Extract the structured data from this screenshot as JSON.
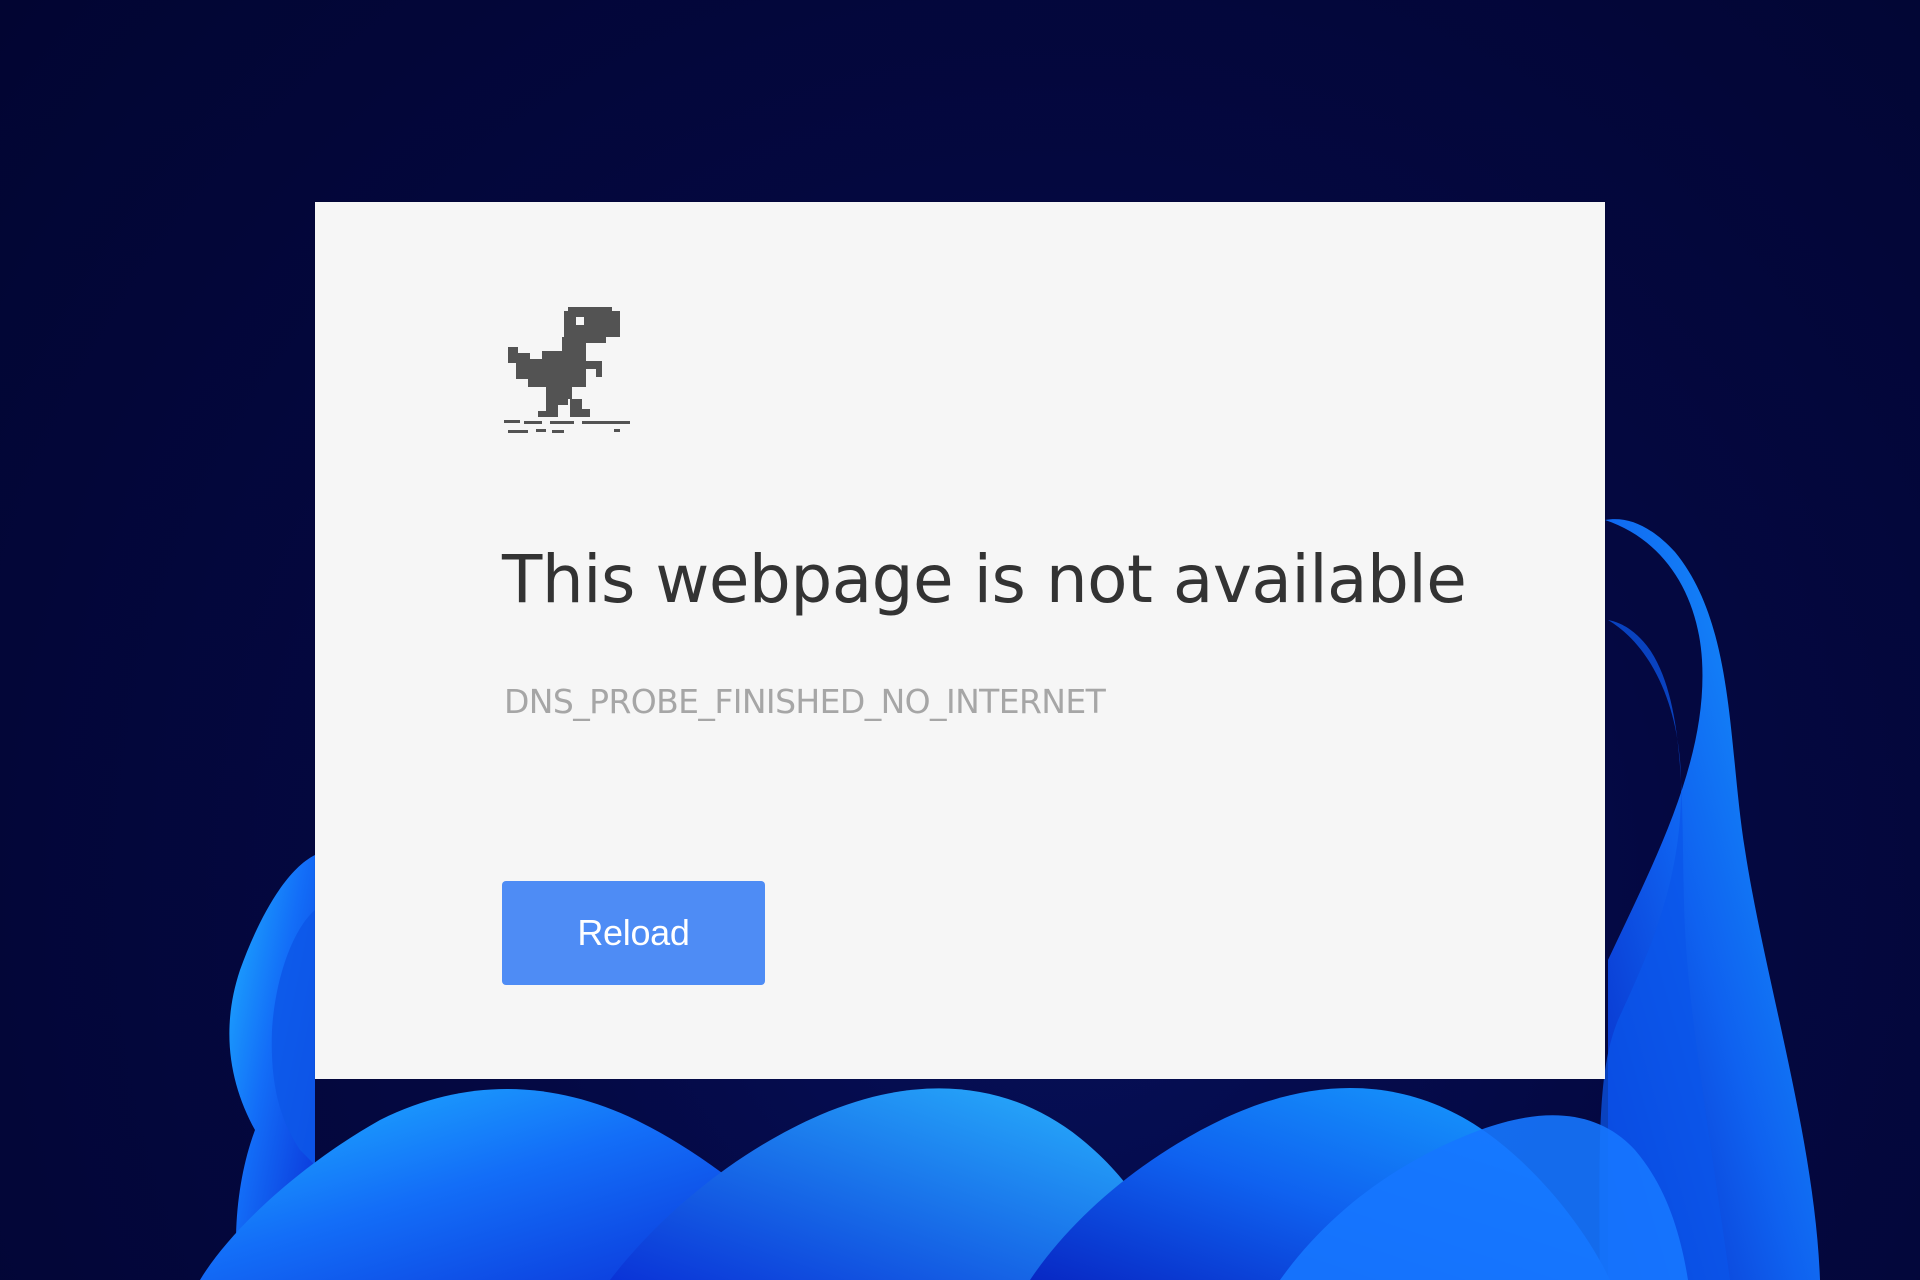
{
  "page": {
    "title": "This webpage is not available",
    "error_code": "DNS_PROBE_FINISHED_NO_INTERNET",
    "reload_label": "Reload",
    "icon": "offline-dino-icon"
  },
  "colors": {
    "background": "#03063a",
    "card": "#f6f6f6",
    "title": "#333333",
    "error_code": "#a6a6a6",
    "reload_button": "#4e8cf5",
    "wallpaper_blue": "#1a73ff"
  }
}
